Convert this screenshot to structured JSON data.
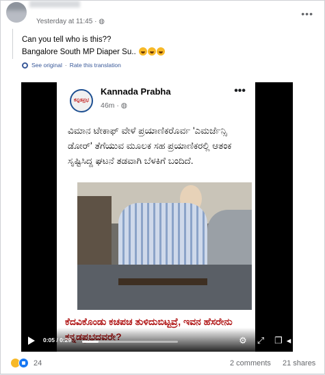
{
  "post": {
    "timestamp": "Yesterday at 11:45",
    "timestamp_separator": "·",
    "text_line1": "Can you tell who is this??",
    "text_line2": "Bangalore South MP Diaper Su..",
    "see_original": "See original",
    "rate_translation": "Rate this translation",
    "separator": "·"
  },
  "video": {
    "page_name": "Kannada Prabha",
    "page_time": "46m",
    "logo_text": "ಕನ್ನಡಪ್ರಭ",
    "kannada_text": "ವಿಮಾನ ಟೇಕಾಫ್ ವೇಳೆ ಪ್ರಯಾಣಿಕರೊರ್ವ 'ಎಮರ್ಜೆನ್ಸಿ ಡೋರ್' ತೆಗೆಯುವ ಮೂಲಕ ಸಹ ಪ್ರಯಾಣಿಕರಲ್ಲಿ ಆತಂಕ ಸೃಷ್ಟಿಸಿದ್ದ ಘಟನೆ ತಡವಾಗಿ ಬೆಳಕಿಗೆ ಬಂದಿದೆ.",
    "red_caption": "ಕೆದವಿಕೊಂಡು ಕಚಪಚ ತುಳಿದುಬಿಟ್ಟವ್ರೆ, ಇವನ ಹೆಸರೇನು ಕನ್ನಡಪ್ರಭದವರೇ?",
    "time_readout": "0:05 / 0:29",
    "progress": 0.17
  },
  "footer": {
    "reaction_count": "24",
    "comments": "2 comments",
    "shares": "21 shares"
  },
  "colors": {
    "link": "#385898",
    "secondary_text": "#65676b",
    "like_blue": "#1877f2",
    "haha_yellow": "#f7b928",
    "caption_red": "#b01515"
  },
  "icons": [
    "public-globe-icon",
    "more-options-icon",
    "gear-icon",
    "play-icon",
    "settings-icon",
    "fullscreen-icon",
    "volume-icon",
    "haha-reaction-icon",
    "like-reaction-icon"
  ]
}
